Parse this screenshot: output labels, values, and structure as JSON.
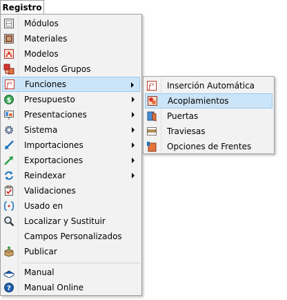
{
  "menubar": {
    "title": "Registro"
  },
  "menu": {
    "items": [
      {
        "label": "Módulos",
        "icon": "module-icon"
      },
      {
        "label": "Materiales",
        "icon": "material-icon"
      },
      {
        "label": "Modelos",
        "icon": "model-icon"
      },
      {
        "label": "Modelos Grupos",
        "icon": "model-group-icon"
      },
      {
        "label": "Funciones",
        "icon": "function-icon",
        "submenu": true,
        "highlighted": true
      },
      {
        "label": "Presupuesto",
        "icon": "budget-icon",
        "submenu": true
      },
      {
        "label": "Presentaciones",
        "icon": "presentation-icon",
        "submenu": true
      },
      {
        "label": "Sistema",
        "icon": "gear-icon",
        "submenu": true
      },
      {
        "label": "Importaciones",
        "icon": "import-icon",
        "submenu": true
      },
      {
        "label": "Exportaciones",
        "icon": "export-icon",
        "submenu": true
      },
      {
        "label": "Reindexar",
        "icon": "reindex-icon",
        "submenu": true
      },
      {
        "label": "Validaciones",
        "icon": "validation-icon"
      },
      {
        "label": "Usado en",
        "icon": "used-in-icon"
      },
      {
        "label": "Localizar y Sustituir",
        "icon": "search-icon"
      },
      {
        "label": "Campos Personalizados",
        "icon": "none"
      },
      {
        "label": "Publicar",
        "icon": "publish-icon"
      },
      {
        "label": "Manual",
        "icon": "book-icon"
      },
      {
        "label": "Manual Online",
        "icon": "help-icon"
      }
    ]
  },
  "submenu": {
    "items": [
      {
        "label": "Inserción Automática",
        "icon": "auto-insert-icon"
      },
      {
        "label": "Acoplamientos",
        "icon": "coupling-icon",
        "highlighted": true
      },
      {
        "label": "Puertas",
        "icon": "door-icon"
      },
      {
        "label": "Traviesas",
        "icon": "crossbar-icon"
      },
      {
        "label": "Opciones de Frentes",
        "icon": "front-options-icon"
      }
    ]
  },
  "colors": {
    "highlight_bg": "#cce4f7",
    "highlight_border": "#99c9ef",
    "menu_bg": "#f2f2f2"
  }
}
